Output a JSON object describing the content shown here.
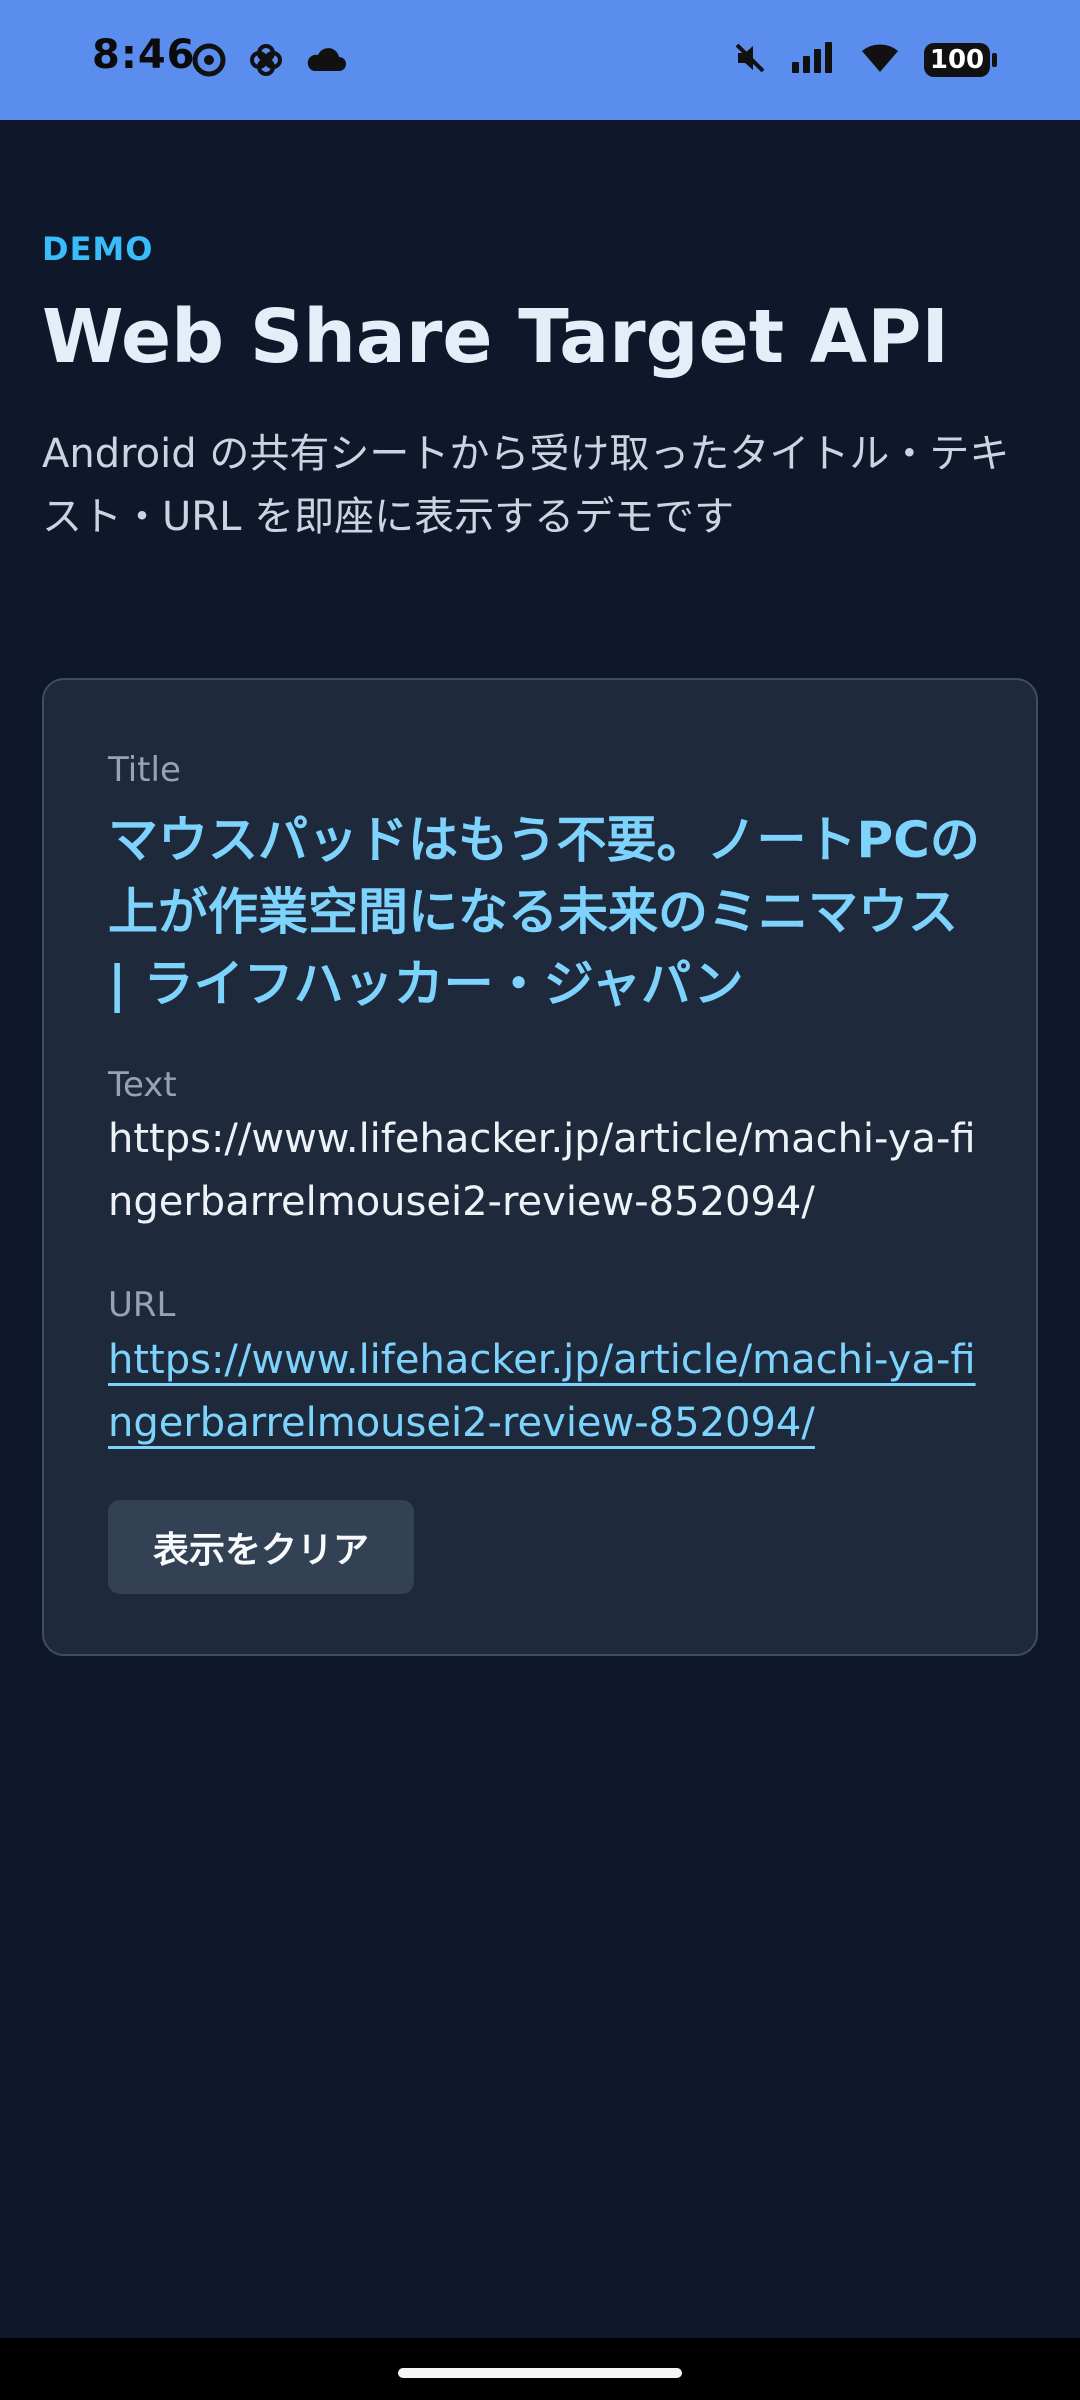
{
  "status_bar": {
    "time": "8:46",
    "battery": "100",
    "icons": [
      "chrome-icon",
      "pinwheel-icon",
      "cloud-icon",
      "mute-icon",
      "cellular-signal-icon",
      "wifi-icon",
      "battery-icon"
    ]
  },
  "page": {
    "eyebrow": "DEMO",
    "title": "Web Share Target API",
    "description": "Android の共有シートから受け取ったタイトル・テキスト・URL を即座に表示するデモです"
  },
  "shared": {
    "title_label": "Title",
    "title_value": "マウスパッドはもう不要。ノートPCの上が作業空間になる未来のミニマウス | ライフハッカー・ジャパン",
    "text_label": "Text",
    "text_value": "https://www.lifehacker.jp/article/machi-ya-fingerbarrelmousei2-review-852094/",
    "url_label": "URL",
    "url_value": "https://www.lifehacker.jp/article/machi-ya-fingerbarrelmousei2-review-852094/"
  },
  "actions": {
    "clear_label": "表示をクリア"
  },
  "colors": {
    "status_bar": "#5b8def",
    "background": "#0f172a",
    "card": "#1e293b",
    "accent": "#38bdf8",
    "link": "#7dd3fc",
    "button": "#334155"
  }
}
